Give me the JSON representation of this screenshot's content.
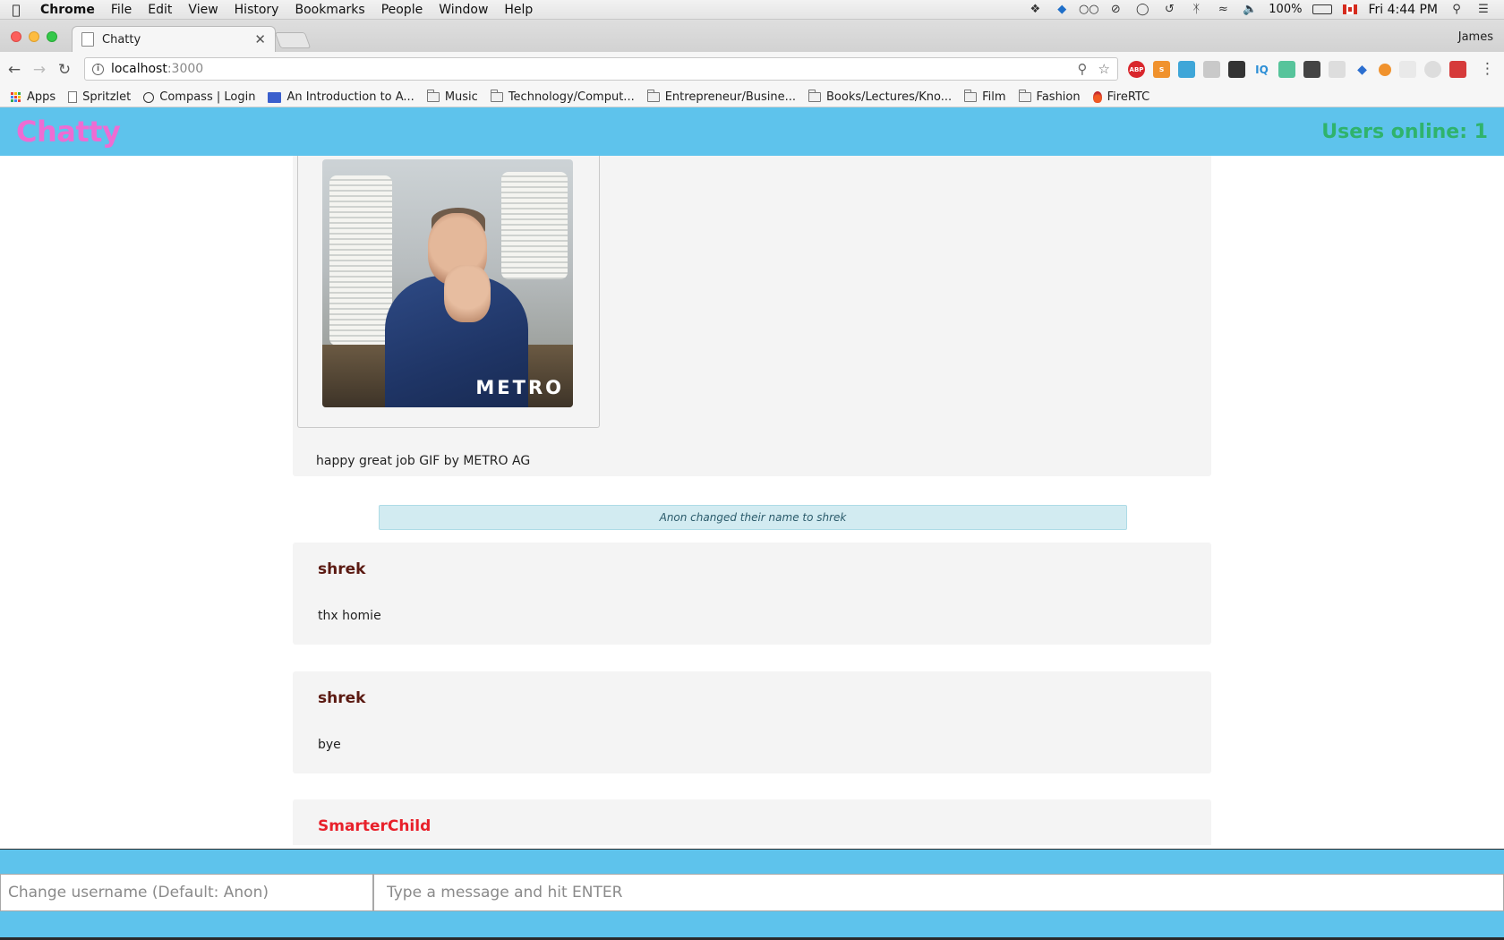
{
  "menubar": {
    "app": "Chrome",
    "items": [
      "File",
      "Edit",
      "View",
      "History",
      "Bookmarks",
      "People",
      "Window",
      "Help"
    ],
    "battery": "100%",
    "clock": "Fri 4:44 PM"
  },
  "browser": {
    "tab_title": "Chatty",
    "profile": "James",
    "url_host": "localhost",
    "url_port": ":3000",
    "bookmarks": [
      {
        "label": "Apps",
        "icon": "apps-grid-icon"
      },
      {
        "label": "Spritzlet",
        "icon": "page-icon"
      },
      {
        "label": "Compass | Login",
        "icon": "compass-icon"
      },
      {
        "label": "An Introduction to A...",
        "icon": "site-icon"
      },
      {
        "label": "Music",
        "icon": "folder-icon"
      },
      {
        "label": "Technology/Comput...",
        "icon": "folder-icon"
      },
      {
        "label": "Entrepreneur/Busine...",
        "icon": "folder-icon"
      },
      {
        "label": "Books/Lectures/Kno...",
        "icon": "folder-icon"
      },
      {
        "label": "Film",
        "icon": "folder-icon"
      },
      {
        "label": "Fashion",
        "icon": "folder-icon"
      },
      {
        "label": "FireRTC",
        "icon": "fire-icon"
      }
    ],
    "extensions": [
      "ABP",
      "s",
      "IQ"
    ]
  },
  "app": {
    "brand": "Chatty",
    "users_online": "Users online: 1",
    "colors": {
      "nav_bg": "#5ec3ec",
      "brand": "#ee6cd3",
      "users_online": "#2fb36c",
      "card_bg": "#f4f4f4",
      "notice_bg": "#d2ebf1"
    },
    "gif_message": {
      "gif_watermark": "METRO",
      "caption": "happy great job GIF by METRO AG"
    },
    "notification": "Anon changed their name to shrek",
    "messages": [
      {
        "username": "shrek",
        "text": "thx homie",
        "color": "#5b1a12"
      },
      {
        "username": "shrek",
        "text": "bye",
        "color": "#5b1a12"
      },
      {
        "username": "SmarterChild",
        "text": "",
        "color": "#e8202a"
      }
    ],
    "footer": {
      "username_placeholder": "Change username (Default: Anon)",
      "message_placeholder": "Type a message and hit ENTER"
    }
  }
}
